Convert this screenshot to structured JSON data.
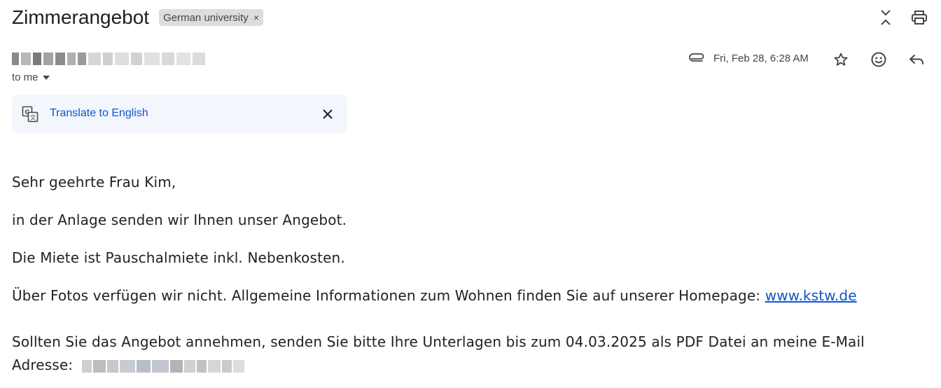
{
  "email": {
    "subject": "Zimmerangebot",
    "label": "German university",
    "label_remove": "×",
    "recipient_text": "to me",
    "date": "Fri, Feb 28, 6:28 AM"
  },
  "icons": {
    "expand": "expand-collapse-icon",
    "print": "print-icon",
    "attachment": "paperclip-icon",
    "star": "star-icon",
    "emoji": "emoji-reaction-icon",
    "reply": "reply-icon",
    "translate": "translate-icon",
    "close": "close-icon"
  },
  "translate": {
    "link_label": "Translate to English"
  },
  "body": {
    "greeting": "Sehr geehrte Frau Kim,",
    "line1": "in der Anlage senden wir Ihnen unser Angebot.",
    "line2": "Die Miete ist Pauschalmiete inkl. Nebenkosten.",
    "line3_prefix": "Über Fotos verfügen wir nicht. Allgemeine Informationen zum Wohnen finden Sie auf unserer Homepage: ",
    "line3_link": "www.kstw.de",
    "line4": "Sollten Sie das Angebot annehmen, senden Sie bitte Ihre Unterlagen bis zum 04.03.2025 als PDF Datei an meine E-Mail",
    "line5_prefix": "Adresse:"
  },
  "colors": {
    "link": "#0b57d0",
    "translate_bar_bg": "#f3f6fc",
    "label_chip_bg": "#dddddd"
  }
}
